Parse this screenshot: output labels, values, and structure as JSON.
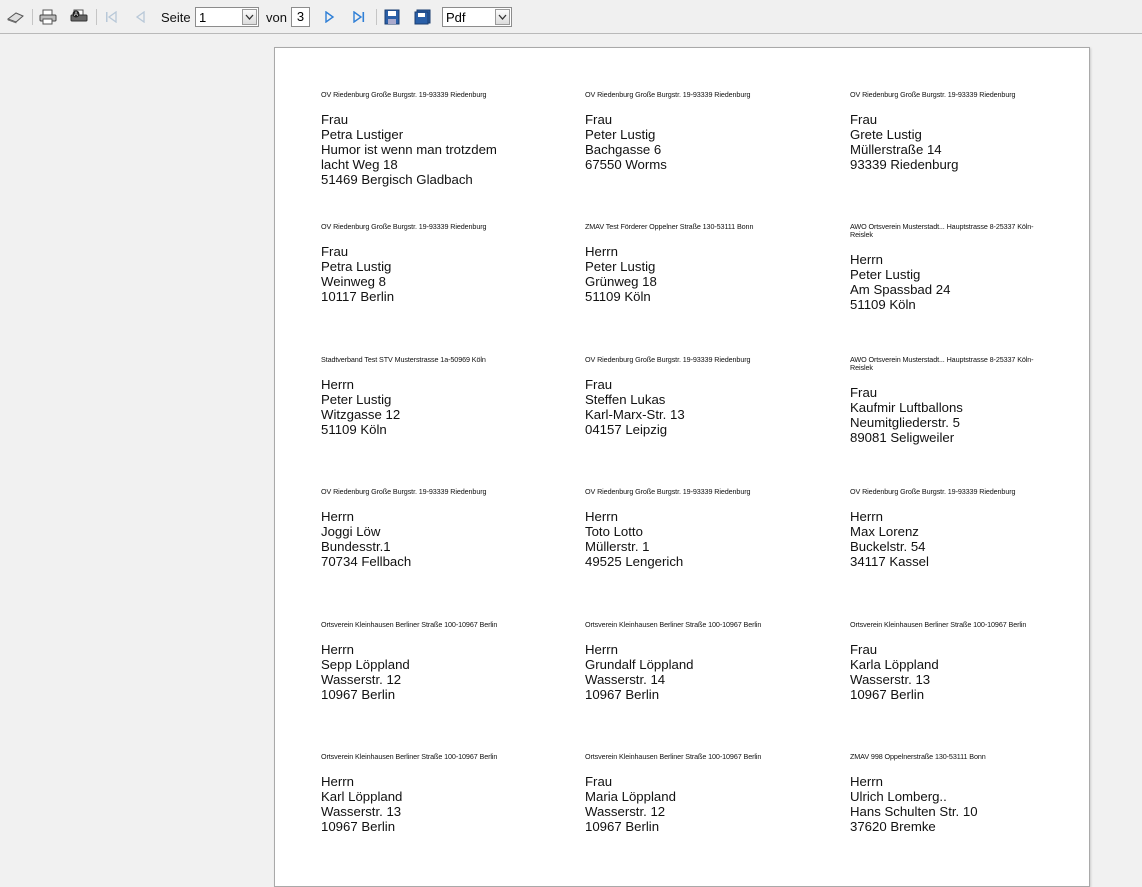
{
  "toolbar": {
    "page_label": "Seite",
    "page_value": "1",
    "of_label": "von",
    "total_pages": "3",
    "format_value": "Pdf",
    "icons": [
      "refresh-icon",
      "print-icon",
      "print-setup-icon",
      "first-page-icon",
      "prev-page-icon",
      "next-page-icon",
      "last-page-icon",
      "save-icon",
      "save-all-icon"
    ]
  },
  "labels": [
    {
      "sender": "OV Riedenburg Große Burgstr. 19-93339 Riedenburg",
      "lines": [
        "Frau",
        "Petra Lustiger",
        "Humor ist wenn man trotzdem",
        "lacht Weg 18",
        "51469 Bergisch Gladbach"
      ]
    },
    {
      "sender": "OV Riedenburg Große Burgstr. 19-93339 Riedenburg",
      "lines": [
        "Frau",
        "Peter Lustig",
        "Bachgasse 6",
        "67550 Worms"
      ]
    },
    {
      "sender": "OV Riedenburg Große Burgstr. 19-93339 Riedenburg",
      "lines": [
        "Frau",
        "Grete Lustig",
        "Müllerstraße 14",
        "93339 Riedenburg"
      ]
    },
    {
      "sender": "OV Riedenburg Große Burgstr. 19-93339 Riedenburg",
      "lines": [
        "Frau",
        "Petra Lustig",
        "Weinweg 8",
        "10117 Berlin"
      ]
    },
    {
      "sender": "ZMAV Test Förderer Oppelner Straße 130-53111 Bonn",
      "lines": [
        "Herrn",
        "Peter Lustig",
        "Grünweg 18",
        "51109 Köln"
      ]
    },
    {
      "sender": "AWO Ortsverein Musterstadt... Hauptstrasse 8-25337 Köln-Reislek",
      "lines": [
        "Herrn",
        "Peter Lustig",
        "Am Spassbad 24",
        "51109 Köln"
      ]
    },
    {
      "sender": "Stadtverband Test STV Musterstrasse 1a-50969 Köln",
      "lines": [
        "Herrn",
        "Peter Lustig",
        "Witzgasse 12",
        "51109 Köln"
      ]
    },
    {
      "sender": "OV Riedenburg Große Burgstr. 19-93339 Riedenburg",
      "lines": [
        "Frau",
        "Steffen Lukas",
        "Karl-Marx-Str. 13",
        "04157 Leipzig"
      ]
    },
    {
      "sender": "AWO Ortsverein Musterstadt... Hauptstrasse 8-25337 Köln-Reislek",
      "lines": [
        "Frau",
        "Kaufmir Luftballons",
        "Neumitgliederstr. 5",
        "89081 Seligweiler"
      ]
    },
    {
      "sender": "OV Riedenburg Große Burgstr. 19-93339 Riedenburg",
      "lines": [
        "Herrn",
        "Joggi Löw",
        "Bundesstr.1",
        "70734 Fellbach"
      ]
    },
    {
      "sender": "OV Riedenburg Große Burgstr. 19-93339 Riedenburg",
      "lines": [
        "Herrn",
        "Toto Lotto",
        "Müllerstr. 1",
        "49525 Lengerich"
      ]
    },
    {
      "sender": "OV Riedenburg Große Burgstr. 19-93339 Riedenburg",
      "lines": [
        "Herrn",
        "Max Lorenz",
        "Buckelstr. 54",
        "34117 Kassel"
      ]
    },
    {
      "sender": "Ortsverein Kleinhausen Berliner Straße 100-10967 Berlin",
      "lines": [
        "Herrn",
        "Sepp Löppland",
        "Wasserstr. 12",
        "10967 Berlin"
      ]
    },
    {
      "sender": "Ortsverein Kleinhausen Berliner Straße 100-10967 Berlin",
      "lines": [
        "Herrn",
        "Grundalf Löppland",
        "Wasserstr. 14",
        "10967 Berlin"
      ]
    },
    {
      "sender": "Ortsverein Kleinhausen Berliner Straße 100-10967 Berlin",
      "lines": [
        "Frau",
        "Karla Löppland",
        "Wasserstr. 13",
        "10967 Berlin"
      ]
    },
    {
      "sender": "Ortsverein Kleinhausen Berliner Straße 100-10967 Berlin",
      "lines": [
        "Herrn",
        "Karl Löppland",
        "Wasserstr. 13",
        "10967 Berlin"
      ]
    },
    {
      "sender": "Ortsverein Kleinhausen Berliner Straße 100-10967 Berlin",
      "lines": [
        "Frau",
        "Maria Löppland",
        "Wasserstr. 12",
        "10967 Berlin"
      ]
    },
    {
      "sender": "ZMAV 998 Oppelnerstraße 130-53111 Bonn",
      "lines": [
        "Herrn",
        "Ulrich Lomberg..",
        "Hans Schulten Str. 10",
        "37620 Bremke"
      ]
    }
  ]
}
